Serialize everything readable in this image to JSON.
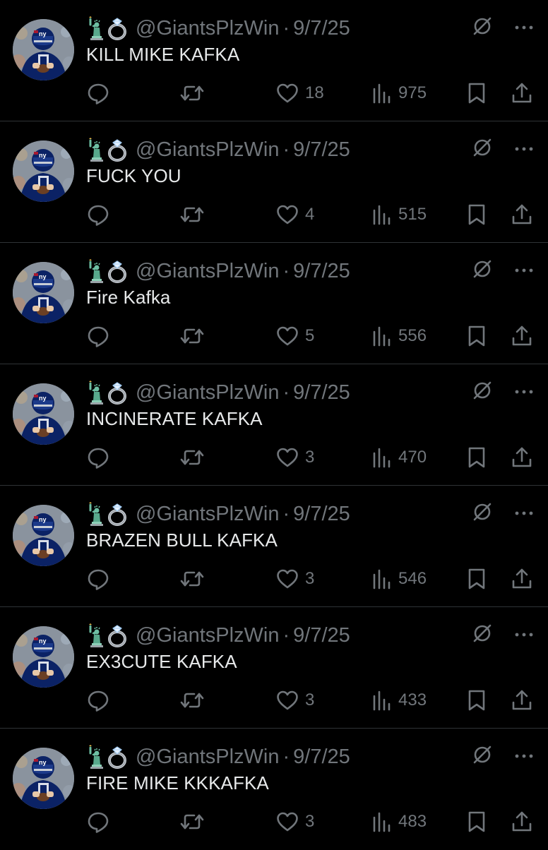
{
  "colors": {
    "background": "#000000",
    "text_primary": "#e7e9ea",
    "text_secondary": "#71767b",
    "divider": "#2f3336",
    "giants_blue": "#0b2265",
    "giants_red": "#a71930"
  },
  "icons": {
    "emoji_1": "statue-of-liberty-icon",
    "emoji_2": "ring-icon",
    "top_right": [
      "grok-icon",
      "more-icon"
    ],
    "actions": [
      "reply-icon",
      "retweet-icon",
      "like-icon",
      "views-icon",
      "bookmark-icon",
      "share-icon"
    ]
  },
  "tweets": [
    {
      "handle": "@GiantsPlzWin",
      "separator": "·",
      "date": "9/7/25",
      "text": "KILL MIKE KAFKA",
      "likes": "18",
      "views": "975"
    },
    {
      "handle": "@GiantsPlzWin",
      "separator": "·",
      "date": "9/7/25",
      "text": "FUCK YOU",
      "likes": "4",
      "views": "515"
    },
    {
      "handle": "@GiantsPlzWin",
      "separator": "·",
      "date": "9/7/25",
      "text": "Fire Kafka",
      "likes": "5",
      "views": "556"
    },
    {
      "handle": "@GiantsPlzWin",
      "separator": "·",
      "date": "9/7/25",
      "text": "INCINERATE KAFKA",
      "likes": "3",
      "views": "470"
    },
    {
      "handle": "@GiantsPlzWin",
      "separator": "·",
      "date": "9/7/25",
      "text": "BRAZEN BULL KAFKA",
      "likes": "3",
      "views": "546"
    },
    {
      "handle": "@GiantsPlzWin",
      "separator": "·",
      "date": "9/7/25",
      "text": "EX3CUTE KAFKA",
      "likes": "3",
      "views": "433"
    },
    {
      "handle": "@GiantsPlzWin",
      "separator": "·",
      "date": "9/7/25",
      "text": "FIRE MIKE KKKAFKA",
      "likes": "3",
      "views": "483"
    }
  ]
}
